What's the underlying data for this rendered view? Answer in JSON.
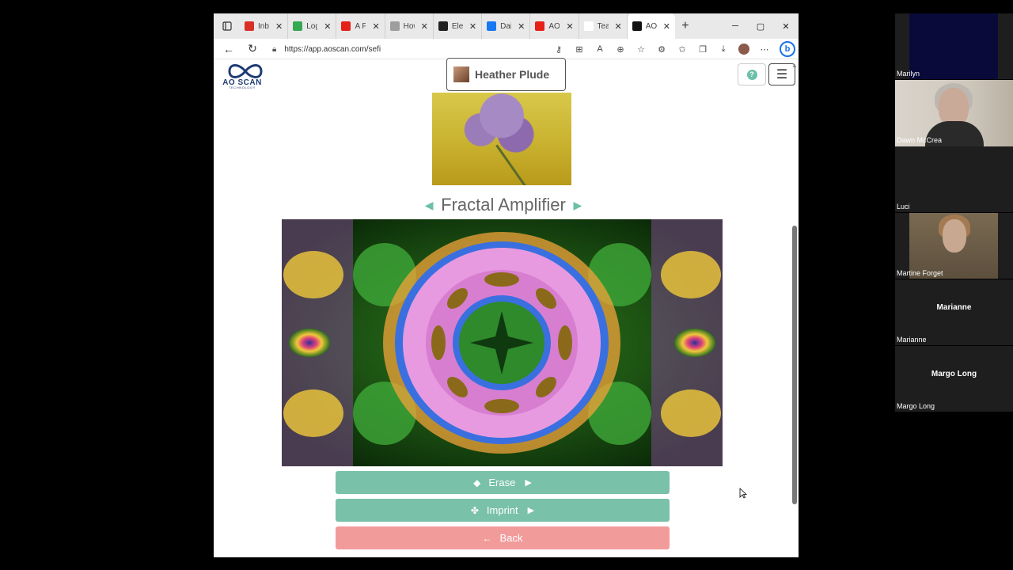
{
  "browser": {
    "tabs": [
      {
        "label": "Inbo",
        "favicon_color": "#d93025"
      },
      {
        "label": "Log",
        "favicon_color": "#34a853"
      },
      {
        "label": "A Fu",
        "favicon_color": "#e62117"
      },
      {
        "label": "How",
        "favicon_color": "#9e9e9e"
      },
      {
        "label": "Elec",
        "favicon_color": "#222222"
      },
      {
        "label": "Daiv",
        "favicon_color": "#1877f2"
      },
      {
        "label": "AO",
        "favicon_color": "#e62117"
      },
      {
        "label": "Tear",
        "favicon_color": "#ffffff"
      },
      {
        "label": "AO",
        "favicon_color": "#111111",
        "active": true
      }
    ],
    "url": "https://app.aoscan.com/sefi"
  },
  "page": {
    "logo_text": "AO SCAN",
    "logo_subtext": "TECHNOLOGY",
    "client_name": "Heather Plude",
    "help_icon": "?",
    "tool_title": "Fractal Amplifier",
    "buttons": {
      "erase": "Erase",
      "imprint": "Imprint",
      "back": "Back"
    }
  },
  "participants": [
    {
      "name": "Marilyn",
      "video": true
    },
    {
      "name": "Dawn McCrea",
      "video": true
    },
    {
      "name": "Luci",
      "video": false
    },
    {
      "name": "Martine Forget",
      "video": true
    },
    {
      "name": "Marianne",
      "video": false,
      "center_name": "Marianne"
    },
    {
      "name": "Margo Long",
      "video": false,
      "center_name": "Margo Long"
    }
  ],
  "colors": {
    "accent_teal": "#79c1a8",
    "back_pink": "#f29b9b",
    "logo_blue": "#1f3b73"
  }
}
